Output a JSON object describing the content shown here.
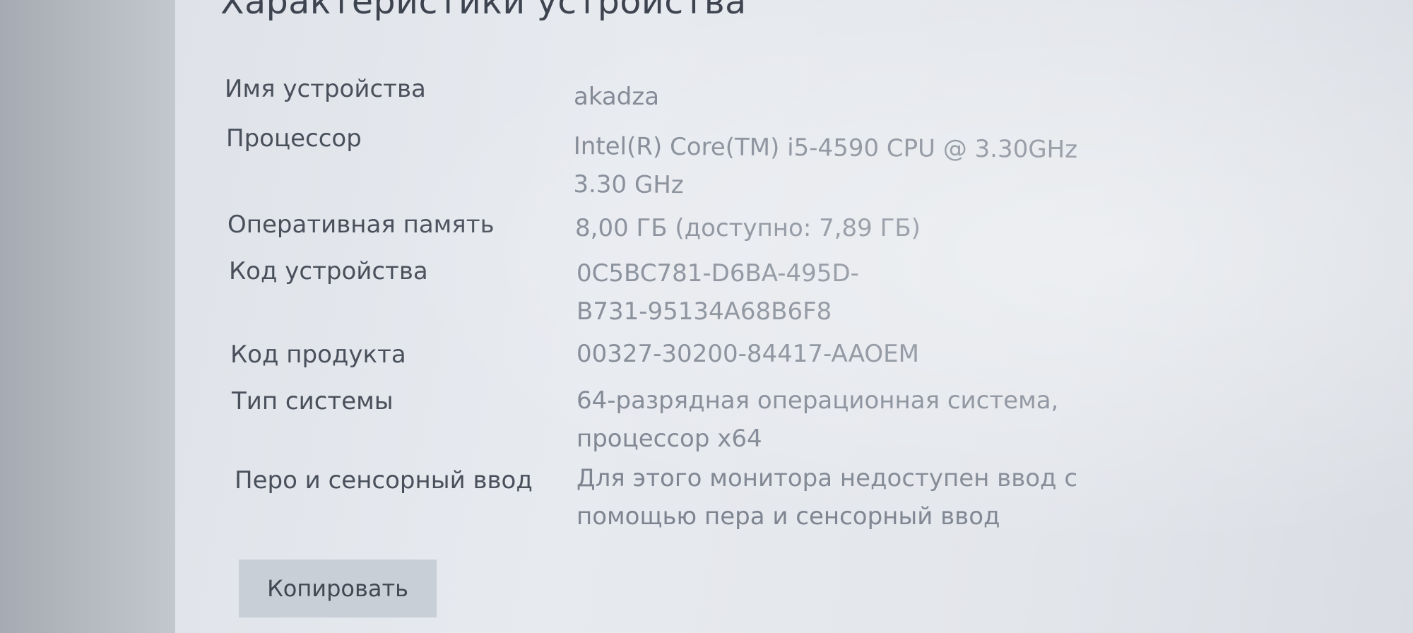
{
  "page": {
    "title": "Характеристики устройства"
  },
  "specs": [
    {
      "label": "Имя устройства",
      "value": [
        "akadza"
      ]
    },
    {
      "label": "Процессор",
      "value": [
        "Intel(R) Core(TM) i5-4590 CPU @ 3.30GHz",
        "3.30 GHz"
      ]
    },
    {
      "label": "Оперативная память",
      "value": [
        "8,00 ГБ (доступно: 7,89 ГБ)"
      ]
    },
    {
      "label": "Код устройства",
      "value": [
        "0C5BC781-D6BA-495D-",
        "B731-95134A68B6F8"
      ]
    },
    {
      "label": "Код продукта",
      "value": [
        "00327-30200-84417-AAOEM"
      ]
    },
    {
      "label": "Тип системы",
      "value": [
        "64-разрядная операционная система,",
        "процессор x64"
      ]
    },
    {
      "label": "Перо и сенсорный ввод",
      "value": [
        "Для этого монитора недоступен ввод с",
        "помощью пера и сенсорный ввод"
      ]
    }
  ],
  "actions": {
    "copy_label": "Копировать"
  }
}
